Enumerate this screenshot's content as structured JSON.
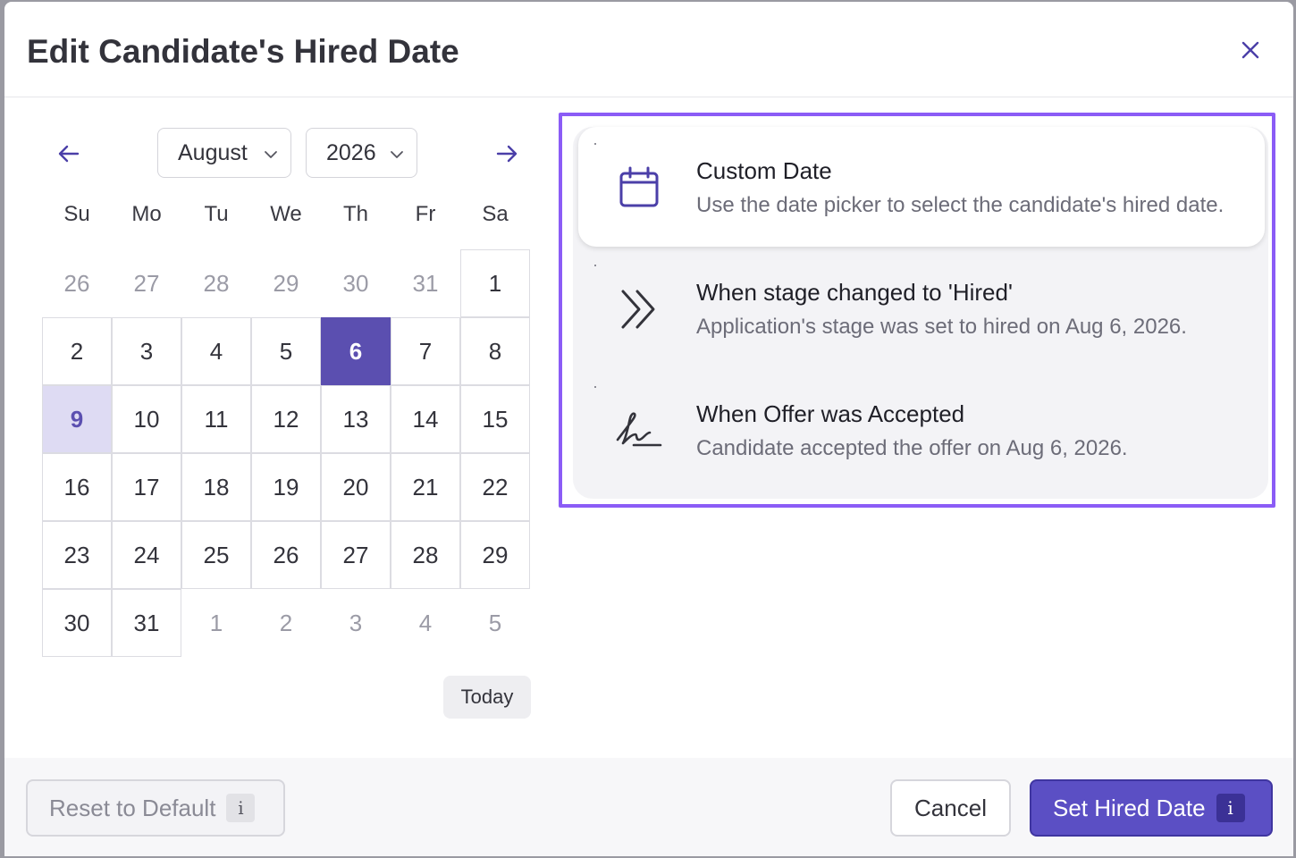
{
  "modal": {
    "title": "Edit Candidate's Hired Date"
  },
  "calendar": {
    "month": "August",
    "year": "2026",
    "weekdays": [
      "Su",
      "Mo",
      "Tu",
      "We",
      "Th",
      "Fr",
      "Sa"
    ],
    "weeks": [
      [
        {
          "d": "26",
          "m": true
        },
        {
          "d": "27",
          "m": true
        },
        {
          "d": "28",
          "m": true
        },
        {
          "d": "29",
          "m": true
        },
        {
          "d": "30",
          "m": true
        },
        {
          "d": "31",
          "m": true
        },
        {
          "d": "1"
        }
      ],
      [
        {
          "d": "2"
        },
        {
          "d": "3"
        },
        {
          "d": "4"
        },
        {
          "d": "5"
        },
        {
          "d": "6",
          "sel": true
        },
        {
          "d": "7"
        },
        {
          "d": "8"
        }
      ],
      [
        {
          "d": "9",
          "today": true
        },
        {
          "d": "10"
        },
        {
          "d": "11"
        },
        {
          "d": "12"
        },
        {
          "d": "13"
        },
        {
          "d": "14"
        },
        {
          "d": "15"
        }
      ],
      [
        {
          "d": "16"
        },
        {
          "d": "17"
        },
        {
          "d": "18"
        },
        {
          "d": "19"
        },
        {
          "d": "20"
        },
        {
          "d": "21"
        },
        {
          "d": "22"
        }
      ],
      [
        {
          "d": "23"
        },
        {
          "d": "24"
        },
        {
          "d": "25"
        },
        {
          "d": "26"
        },
        {
          "d": "27"
        },
        {
          "d": "28"
        },
        {
          "d": "29"
        }
      ],
      [
        {
          "d": "30"
        },
        {
          "d": "31"
        },
        {
          "d": "1",
          "m": true
        },
        {
          "d": "2",
          "m": true
        },
        {
          "d": "3",
          "m": true
        },
        {
          "d": "4",
          "m": true
        },
        {
          "d": "5",
          "m": true
        }
      ]
    ],
    "today_label": "Today"
  },
  "options": [
    {
      "title": "Custom Date",
      "description": "Use the date picker to select the candidate's hired date.",
      "icon": "calendar-icon",
      "active": true
    },
    {
      "title": "When stage changed to 'Hired'",
      "description": "Application's stage was set to hired on Aug 6, 2026.",
      "icon": "double-chevron-right-icon",
      "active": false
    },
    {
      "title": "When Offer was Accepted",
      "description": "Candidate accepted the offer on Aug 6, 2026.",
      "icon": "signature-icon",
      "active": false
    }
  ],
  "footer": {
    "reset_label": "Reset to Default",
    "cancel_label": "Cancel",
    "submit_label": "Set Hired Date",
    "info_glyph": "i"
  },
  "colors": {
    "accent": "#5b4fb0",
    "highlight_border": "#8b5cf6",
    "today_bg": "#dedbf3"
  }
}
